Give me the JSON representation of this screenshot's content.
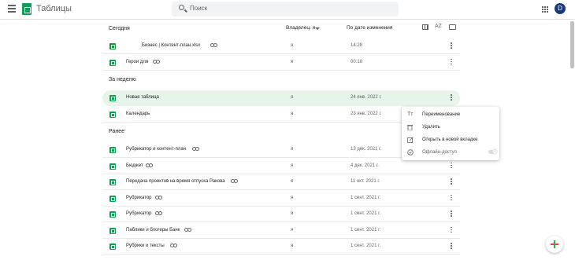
{
  "header": {
    "app_title": "Таблицы",
    "search_placeholder": "Поиск",
    "avatar_letter": "D"
  },
  "listbar": {
    "owner_label": "Владелец: я",
    "date_label": "По дате изменения",
    "sort_icon_text": "AZ"
  },
  "sections": {
    "today": "Сегодня",
    "week": "За неделю",
    "earlier": "Ранее"
  },
  "files_today": [
    {
      "name": "Бизнес | Контент-план.xlsx",
      "owner": "я",
      "date": "14:28",
      "shared": true,
      "type": "xlsx"
    },
    {
      "name": "Герои для",
      "owner": "я",
      "date": "00:18",
      "shared": true,
      "type": "sheet"
    }
  ],
  "files_week": [
    {
      "name": "Новая таблица",
      "owner": "я",
      "date": "24 янв. 2022 г.",
      "shared": false,
      "type": "sheet",
      "selected": true
    },
    {
      "name": "Календарь",
      "owner": "я",
      "date": "23 янв. 2022 г.",
      "shared": false,
      "type": "sheet"
    }
  ],
  "files_earlier": [
    {
      "name": "Рубрикатор и контент-план",
      "owner": "я",
      "date": "13 дек. 2021 г.",
      "shared": true,
      "type": "sheet"
    },
    {
      "name": "Бюджет",
      "owner": "я",
      "date": "4 дек. 2021 г.",
      "shared": true,
      "type": "sheet"
    },
    {
      "name": "Передача проектов на время отпуска Ракова",
      "owner": "я",
      "date": "11 окт. 2021 г.",
      "shared": true,
      "type": "sheet"
    },
    {
      "name": "Рубрикатор",
      "owner": "я",
      "date": "1 сент. 2021 г.",
      "shared": true,
      "type": "sheet"
    },
    {
      "name": "Рубрикатор",
      "owner": "я",
      "date": "1 сент. 2021 г.",
      "shared": true,
      "type": "sheet"
    },
    {
      "name": "Паблики и блогеры Банк",
      "owner": "я",
      "date": "1 сент. 2021 г.",
      "shared": true,
      "type": "sheet"
    },
    {
      "name": "Рубрики и тексты",
      "owner": "я",
      "date": "1 сент. 2021 г.",
      "shared": true,
      "type": "sheet"
    }
  ],
  "context_menu": {
    "rename": "Переименование",
    "rename_icon_text": "Tт",
    "delete": "Удалить",
    "open_new_tab": "Открыть в новой вкладке",
    "offline": "Офлайн-доступ"
  },
  "colors": {
    "sheets_green": "#0f9d58",
    "selected_row": "#e6f4ea",
    "avatar": "#1a3a7a"
  }
}
